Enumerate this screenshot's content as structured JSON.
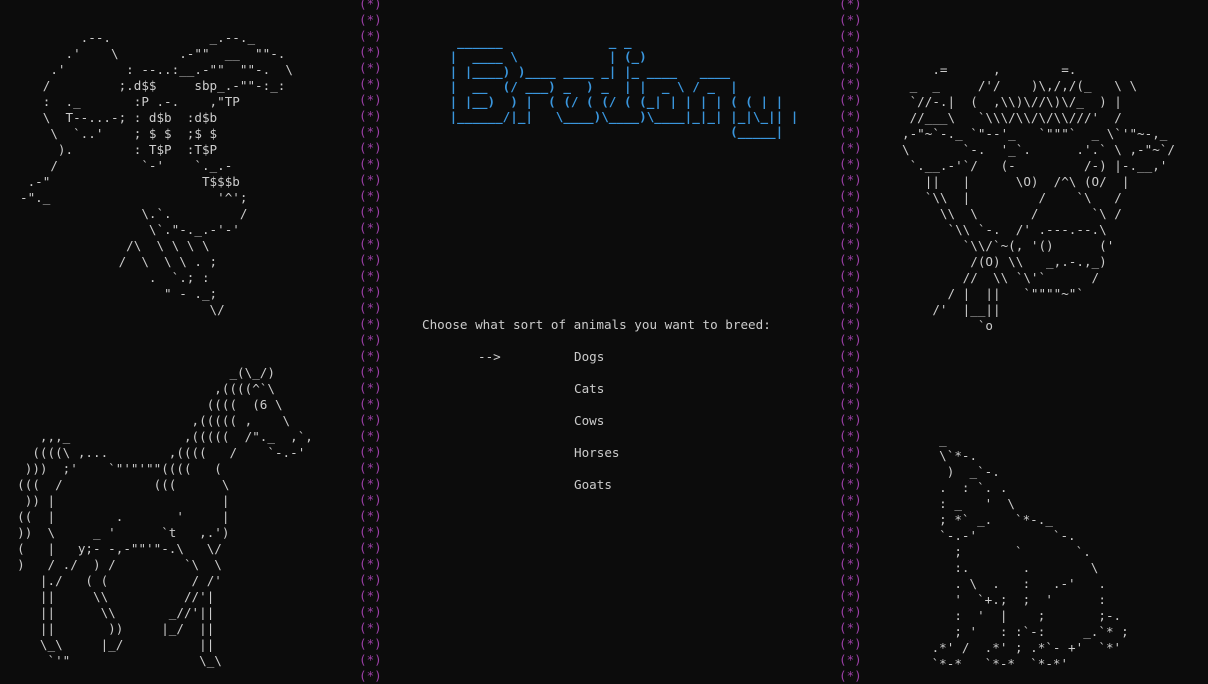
{
  "border_glyph": "(*)",
  "colors": {
    "background": "#0c0c0c",
    "text": "#cccccc",
    "border": "#9b3fa6",
    "title": "#3a96dd"
  },
  "title_art": "  ______              _ _\n |  ____ \\            | (_)\n | |____) )____ ____ _| |_ ____   ____\n |  __  (/ ___) _  ) _  | |  _ \\ / _  |\n | |__)  ) |  ( (/ ( (/ ( (_| | | | | ( ( | |\n |______/|_|   \\____)\\____)\\____|_|_| |_|\\_|| |\n                                      (_____|",
  "prompt": "Choose what sort of animals you want to breed:",
  "selector": "-->",
  "options": [
    "Dogs",
    "Cats",
    "Cows",
    "Horses",
    "Goats"
  ],
  "selected_index": 0,
  "art": {
    "dog": "        .--.             _.--._\n      .'    \\        .-\"\"  __  \"\"-.\n    .'        : --..:__.-\"\"  \"\"-.  \\\n   /         ;.d$$     sbp_.-\"\"-:_:\n   :  ._       :P .-.    ,\"TP\n   \\  T--...-; : d$b  :d$b\n    \\  `..'    ; $ $  ;$ $\n     ).        : T$P  :T$P\n    /           `-'    `._.-\n .-\"                    T$$$b\n-\"._                      '^';\n                \\.`.         /\n                 \\`.\"-._.-'-'\n              /\\  \\ \\ \\ \\\n             /  \\  \\ \\ . ;\n                 .  `.; :\n                   \" - ._;\n                         \\/",
    "cow": "    .=      ,        =.\n _  _     /'/    )\\,/,/(_   \\ \\\n `//-.|  (  ,\\\\)\\//\\)\\/_  ) |\n //___\\   `\\\\\\/\\\\/\\/\\\\///'  /\n,-\"~`-._ `\"--'_   `\"\"\"`  _ \\`'\"~-,_\n\\       `-.  '_`.      .'.` \\ ,-\"~`/\n `.__.-'`/   (-         /-) |-.__,'\n   ||   |      \\O)  /^\\ (O/  |\n   `\\\\  |         /    `\\   /\n     \\\\  \\       /       `\\ /\n      `\\\\ `-.  /' .---.--.\\\n        `\\\\/`~(, '()      ('\n         /(O) \\\\   _,.-.,_)\n        //  \\\\ `\\'`      /\n      / |  ||   `\"\"\"\"~\"`\n    /'  |__||\n          `o",
    "horse": "                              _(\\_/)\n                            ,((((^`\\\n                           ((((  (6 \\\n                         ,((((( ,    \\\n     ,,,_               ,(((((  /\"._  ,`,\n    ((((\\ ,...        ,((((   /    `-.-'\n   )))  ;'    `\"'\"'\"\"((((   (\n  (((  /            (((      \\\n   )) |                      |\n  ((  |        .       '     |\n  ))  \\     _ '      `t   ,.')\n  (   |   y;- -,-\"\"'\"-.\\   \\/\n  )   / ./  ) /         `\\  \\\n     |./   ( (           / /'\n     ||     \\\\          //'|\n     ||      \\\\       _//'||\n     ||       ))     |_/  ||\n     \\_\\     |_/          ||\n      `'\"                 \\_\\",
    "cat": "  _\n  \\`*-.\n   )  _`-.\n  .  : `. .\n  : _   '  \\\n  ; *` _.   `*-._\n  `-.-'          `-.\n    ;       `       `.\n    :.       .        \\\n    . \\  .   :   .-'   .\n    '  `+.;  ;  '      :\n    :  '  |    ;       ;-.\n    ; '   : :`-:     _.`* ;\n .*' /  .*' ; .*`- +'  `*'\n `*-*   `*-*  `*-*'"
  }
}
